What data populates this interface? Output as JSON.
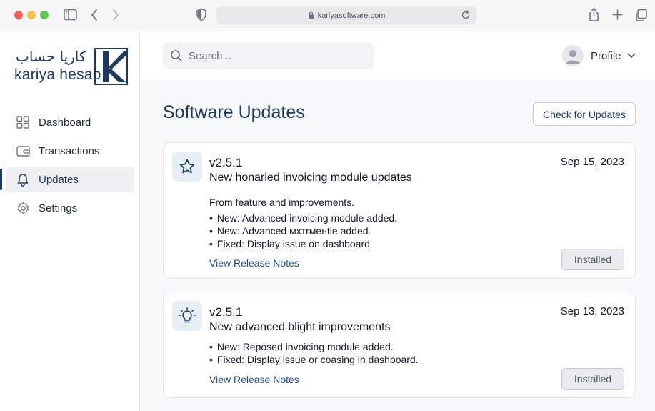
{
  "browser": {
    "url": "kariyasoftware.com"
  },
  "brand": {
    "arabic_name": "كاريا حساب",
    "latin_name": "kariya hesab",
    "color": "#1e3a5f"
  },
  "sidebar": {
    "items": [
      {
        "label": "Dashboard",
        "icon": "grid-icon",
        "active": false
      },
      {
        "label": "Transactions",
        "icon": "wallet-icon",
        "active": false
      },
      {
        "label": "Updates",
        "icon": "bell-icon",
        "active": true
      },
      {
        "label": "Settings",
        "icon": "gear-icon",
        "active": false
      }
    ]
  },
  "topbar": {
    "search_placeholder": "Search...",
    "profile_label": "Profile"
  },
  "main": {
    "title": "Software Updates",
    "check_button": "Check for Updates",
    "updates": [
      {
        "icon": "star-icon",
        "version": "v2.5.1",
        "subtitle": "New honaried invoicing module updates",
        "date": "Sep 15, 2023",
        "summary": "From feature and improvements.",
        "notes": [
          "New: Advanced invoicing module added.",
          "New: Advanced мxтrменtie added.",
          "Fixed: Display issue on dashboard"
        ],
        "link": "View Release Notes",
        "status": "Installed"
      },
      {
        "icon": "lightbulb-icon",
        "version": "v2.5.1",
        "subtitle": "New advanced blight improvements",
        "date": "Sep 13, 2023",
        "notes": [
          "New: Reposed invoicing module added.",
          "Fixed: Display issue or coasing in dashboard."
        ],
        "link": "View Release Notes",
        "status": "Installed"
      }
    ]
  }
}
